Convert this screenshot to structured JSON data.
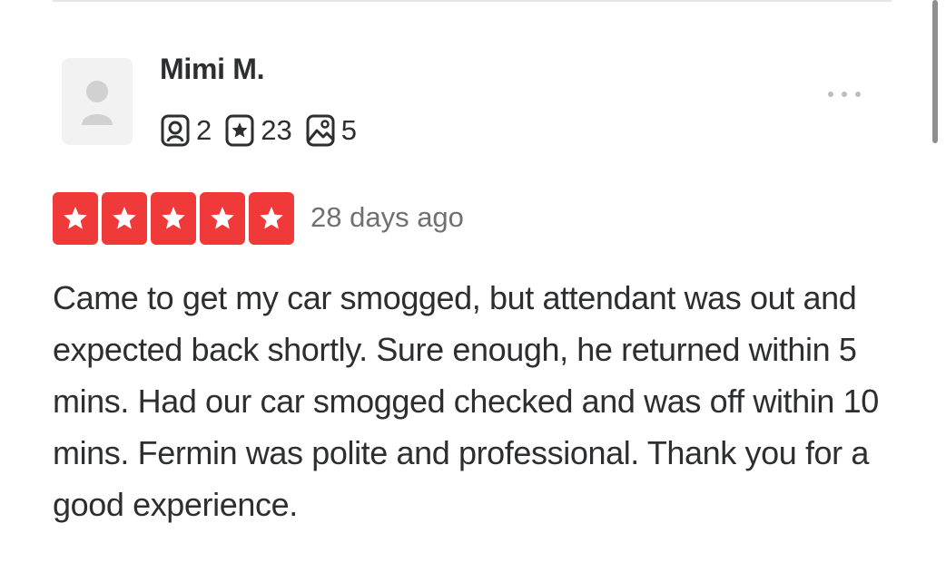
{
  "review": {
    "user": {
      "name": "Mimi M.",
      "avatar_icon": "default-user-icon",
      "stats": [
        {
          "icon": "friends-icon",
          "value": "2"
        },
        {
          "icon": "reviews-icon",
          "value": "23"
        },
        {
          "icon": "photos-icon",
          "value": "5"
        }
      ]
    },
    "more_icon": "more-horizontal-icon",
    "rating": {
      "stars": 5,
      "max": 5,
      "color": "#f03a3a"
    },
    "date": "28 days ago",
    "text": "Came to get my car smogged, but attendant was out and expected back shortly. Sure enough, he returned within 5 mins. Had our car smogged checked and was off within 10 mins. Fermin was polite and professional. Thank you for a good experience."
  }
}
